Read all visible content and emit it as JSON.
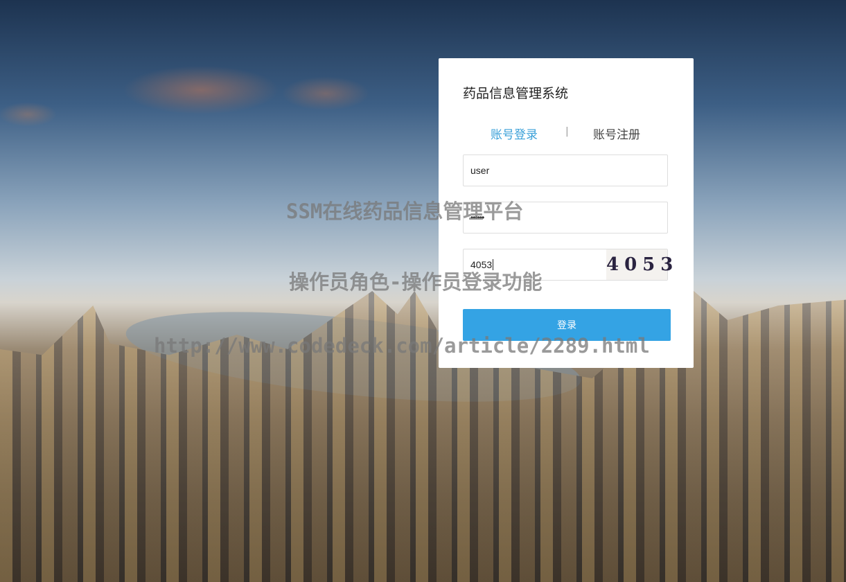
{
  "login": {
    "title": "药品信息管理系统",
    "tab_login": "账号登录",
    "tab_separator": "|",
    "tab_register": "账号注册",
    "username_value": "user",
    "password_value": "••••••",
    "captcha_value": "4053",
    "captcha_image_text": "4053",
    "submit_label": "登录",
    "active_tab_color": "#3aa0d8",
    "button_color": "#34a3e4"
  },
  "watermark": {
    "line1": "SSM在线药品信息管理平台",
    "line2": "操作员角色-操作员登录功能",
    "line3": "http://www.codedeck.com/article/2289.html"
  }
}
